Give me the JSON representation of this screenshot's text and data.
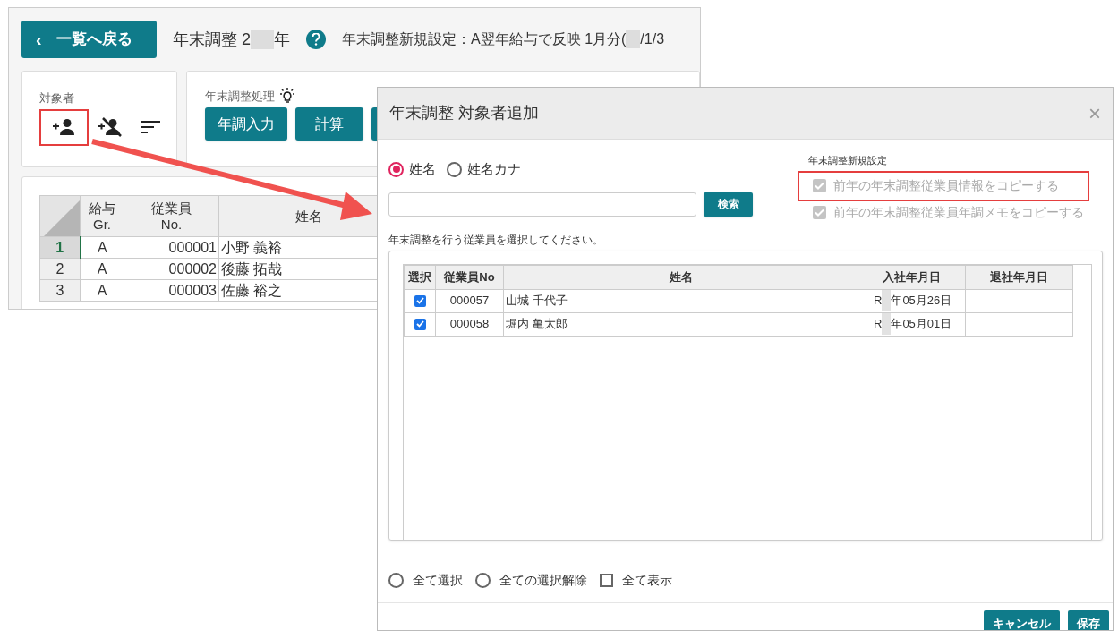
{
  "back_window": {
    "back_button": "一覧へ戻る",
    "back_icon": "‹",
    "title_prefix": "年末調整 2",
    "title_suffix": "年",
    "setting_prefix": "年末調整新規設定：A翌年給与で反映 1月分(",
    "setting_suffix": "/1/3",
    "target_panel": {
      "label": "対象者"
    },
    "process_panel": {
      "label": "年末調整処理",
      "buttons": [
        "年調入力",
        "計算"
      ]
    },
    "table": {
      "columns": [
        "給与\nGr.",
        "従業員\nNo.",
        "姓名"
      ],
      "rows": [
        {
          "number": "1",
          "selected": true,
          "cells": [
            "A",
            "000001",
            "小野 義裕"
          ]
        },
        {
          "number": "2",
          "selected": false,
          "cells": [
            "A",
            "000002",
            "後藤 拓哉"
          ]
        },
        {
          "number": "3",
          "selected": false,
          "cells": [
            "A",
            "000003",
            "佐藤 裕之"
          ]
        }
      ]
    }
  },
  "dialog": {
    "title": "年末調整 対象者追加",
    "close": "×",
    "search_modes": [
      {
        "label": "姓名",
        "selected": true
      },
      {
        "label": "姓名カナ",
        "selected": false
      }
    ],
    "search_button": "検索",
    "settings_label": "年末調整新規設定",
    "settings": [
      {
        "label": "前年の年末調整従業員情報をコピーする",
        "checked": true,
        "disabled": true,
        "highlighted": true
      },
      {
        "label": "前年の年末調整従業員年調メモをコピーする",
        "checked": true,
        "disabled": true,
        "highlighted": false
      }
    ],
    "instruction": "年末調整を行う従業員を選択してください。",
    "table": {
      "columns": [
        "選択",
        "従業員No",
        "姓名",
        "入社年月日",
        "退社年月日"
      ],
      "rows": [
        {
          "checked": true,
          "number": "000057",
          "name": "山城 千代子",
          "hire_prefix": "R",
          "hire_suffix": "年05月26日"
        },
        {
          "checked": true,
          "number": "000058",
          "name": "堀内 亀太郎",
          "hire_prefix": "R",
          "hire_suffix": "年05月01日"
        }
      ]
    },
    "bottom_options": [
      {
        "kind": "radio",
        "label": "全て選択",
        "checked": false
      },
      {
        "kind": "radio",
        "label": "全ての選択解除",
        "checked": false
      },
      {
        "kind": "checkbox",
        "label": "全て表示",
        "checked": false
      }
    ],
    "buttons": [
      "キャンセル",
      "保存"
    ]
  }
}
